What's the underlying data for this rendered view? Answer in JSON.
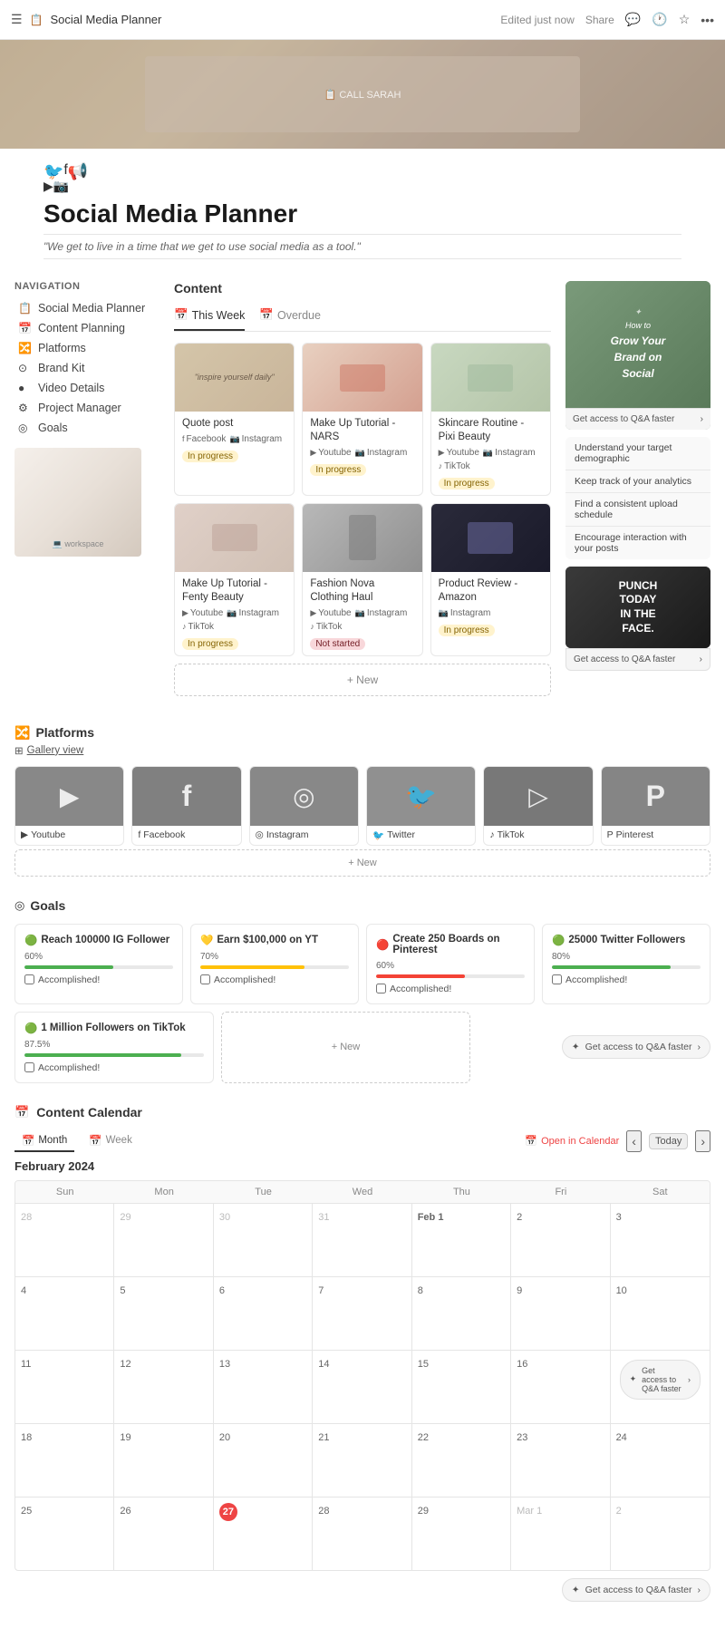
{
  "topbar": {
    "title": "Social Media Planner",
    "edited": "Edited just now",
    "share_label": "Share"
  },
  "page": {
    "title": "Social Media Planner",
    "quote": "\"We get to live in a time that we get to use social media as a tool.\""
  },
  "navigation": {
    "title": "Navigation",
    "items": [
      {
        "label": "Social Media Planner",
        "icon": "📋"
      },
      {
        "label": "Content Planning",
        "icon": "📅"
      },
      {
        "label": "Platforms",
        "icon": "🔀"
      },
      {
        "label": "Brand Kit",
        "icon": "⊙"
      },
      {
        "label": "Video Details",
        "icon": "●"
      },
      {
        "label": "Project Manager",
        "icon": "⚙"
      },
      {
        "label": "Goals",
        "icon": "◎"
      }
    ]
  },
  "content": {
    "title": "Content",
    "tabs": [
      {
        "label": "This Week",
        "icon": "📅",
        "active": true
      },
      {
        "label": "Overdue",
        "icon": "📅",
        "active": false
      }
    ],
    "cards": [
      {
        "title": "Quote post",
        "platforms": [
          "Facebook",
          "Instagram"
        ],
        "platform_icons": [
          "f",
          "📷"
        ],
        "status": "In progress",
        "status_type": "inprogress",
        "img_class": "img-quote"
      },
      {
        "title": "Make Up Tutorial - NARS",
        "platforms": [
          "Youtube",
          "Instagram"
        ],
        "platform_icons": [
          "▶",
          "📷"
        ],
        "status": "In progress",
        "status_type": "inprogress",
        "img_class": "img-makeup"
      },
      {
        "title": "Skincare Routine - Pixi Beauty",
        "platforms": [
          "Youtube",
          "Instagram",
          "TikTok"
        ],
        "platform_icons": [
          "▶",
          "📷",
          "♪"
        ],
        "status": "In progress",
        "status_type": "inprogress",
        "img_class": "img-skincare"
      },
      {
        "title": "Make Up Tutorial - Fenty Beauty",
        "platforms": [
          "Youtube",
          "Instagram",
          "TikTok"
        ],
        "platform_icons": [
          "▶",
          "📷",
          "♪"
        ],
        "status": "In progress",
        "status_type": "inprogress",
        "img_class": "img-fenty"
      },
      {
        "title": "Fashion Nova Clothing Haul",
        "platforms": [
          "Youtube",
          "Instagram",
          "TikTok"
        ],
        "platform_icons": [
          "▶",
          "📷",
          "♪"
        ],
        "status": "Not started",
        "status_type": "notstarted",
        "img_class": "img-fashion"
      },
      {
        "title": "Product Review - Amazon",
        "platforms": [
          "Instagram"
        ],
        "platform_icons": [
          "📷"
        ],
        "status": "In progress",
        "status_type": "inprogress",
        "img_class": "img-product"
      }
    ],
    "add_new": "+ New"
  },
  "right_banner": {
    "main_text": "How to\nGrow Your\nBrand on\nSocial",
    "cta": "Get access to Q&A faster",
    "tips": [
      "Understand your target demographic",
      "Keep track of your analytics",
      "Find a consistent upload schedule",
      "Encourage interaction with your posts"
    ],
    "motivational": "PUNCH\nTODAY\nIN THE\nFACE.",
    "cta2": "Get access to Q&A faster"
  },
  "platforms": {
    "title": "Platforms",
    "view_label": "Gallery view",
    "items": [
      {
        "name": "Youtube",
        "icon": "▶",
        "bg": "yt-bg"
      },
      {
        "name": "Facebook",
        "icon": "f",
        "bg": "fb-bg"
      },
      {
        "name": "Instagram",
        "icon": "◎",
        "bg": "ig-bg"
      },
      {
        "name": "Twitter",
        "icon": "🐦",
        "bg": "tw-bg"
      },
      {
        "name": "TikTok",
        "icon": "♪",
        "bg": "tt-bg"
      },
      {
        "name": "Pinterest",
        "icon": "P",
        "bg": "pt-bg"
      }
    ],
    "add_new": "+ New"
  },
  "goals": {
    "title": "Goals",
    "icon": "◎",
    "items": [
      {
        "title": "Reach 100000 IG Follower",
        "icon": "🟢",
        "percent": "60%",
        "progress": 60,
        "color": "#4caf50",
        "accomplished": false,
        "accomplished_label": "Accomplished!"
      },
      {
        "title": "Earn $100,000 on YT",
        "icon": "💛",
        "percent": "70%",
        "progress": 70,
        "color": "#ffc107",
        "accomplished": false,
        "accomplished_label": "Accomplished!"
      },
      {
        "title": "Create 250 Boards on Pinterest",
        "icon": "🔴",
        "percent": "60%",
        "progress": 60,
        "color": "#f44336",
        "accomplished": false,
        "accomplished_label": "Accomplished!"
      },
      {
        "title": "25000 Twitter Followers",
        "icon": "🟢",
        "percent": "80%",
        "progress": 80,
        "color": "#4caf50",
        "accomplished": false,
        "accomplished_label": "Accomplished!"
      }
    ],
    "bottom_item": {
      "title": "1 Million Followers on TikTok",
      "icon": "🟢",
      "percent": "87.5%",
      "progress": 87.5,
      "color": "#4caf50",
      "accomplished": false,
      "accomplished_label": "Accomplished!"
    },
    "add_new": "+ New",
    "cta": "Get access to Q&A faster"
  },
  "calendar": {
    "title": "Content Calendar",
    "tabs": [
      "Month",
      "Week"
    ],
    "active_tab": "Month",
    "month_title": "February 2024",
    "open_calendar": "Open in Calendar",
    "today_btn": "Today",
    "day_headers": [
      "Sun",
      "Mon",
      "Tue",
      "Wed",
      "Thu",
      "Fri",
      "Sat"
    ],
    "weeks": [
      [
        {
          "date": "28",
          "other": true
        },
        {
          "date": "29",
          "other": true
        },
        {
          "date": "30",
          "other": true
        },
        {
          "date": "31",
          "other": true
        },
        {
          "date": "Feb 1",
          "bold": true
        },
        {
          "date": "2"
        },
        {
          "date": "3"
        }
      ],
      [
        {
          "date": "4"
        },
        {
          "date": "5"
        },
        {
          "date": "6"
        },
        {
          "date": "7"
        },
        {
          "date": "8"
        },
        {
          "date": "9"
        },
        {
          "date": "10"
        }
      ],
      [
        {
          "date": "11"
        },
        {
          "date": "12"
        },
        {
          "date": "13"
        },
        {
          "date": "14"
        },
        {
          "date": "15"
        },
        {
          "date": "16"
        },
        {
          "date": ""
        }
      ],
      [
        {
          "date": "18"
        },
        {
          "date": "19"
        },
        {
          "date": "20"
        },
        {
          "date": "21"
        },
        {
          "date": "22"
        },
        {
          "date": "23"
        },
        {
          "date": "24"
        }
      ],
      [
        {
          "date": "25"
        },
        {
          "date": "26"
        },
        {
          "date": "27",
          "today": true
        },
        {
          "date": "28"
        },
        {
          "date": "29"
        },
        {
          "date": "Mar 1",
          "other": true
        },
        {
          "date": "2",
          "other": true
        }
      ]
    ],
    "cta": "Get access to Q&A faster"
  }
}
